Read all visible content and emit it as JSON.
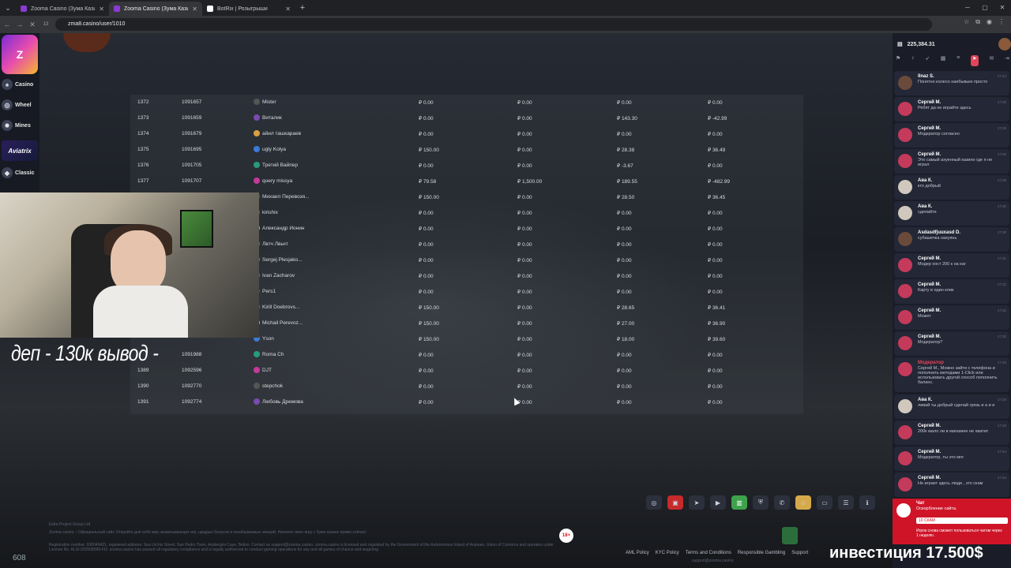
{
  "browser": {
    "tabs": [
      {
        "title": "Zooma Casino (Зума Казино) ...",
        "active": false
      },
      {
        "title": "Zooma Casino (Зума Казино) ...",
        "active": true
      },
      {
        "title": "BotRix | Розыгрыши",
        "active": false
      }
    ],
    "url": "zma8.casino/user/1010",
    "reload_label": "13"
  },
  "sidebar": {
    "logo_text": "Z",
    "items": [
      {
        "label": "Casino",
        "icon": "casino-icon"
      },
      {
        "label": "Wheel",
        "icon": "wheel-icon"
      },
      {
        "label": "Mines",
        "icon": "mines-icon"
      },
      {
        "label": "Classic",
        "icon": "classic-icon"
      }
    ],
    "aviatrix": "Aviatrix"
  },
  "table": {
    "rows": [
      {
        "id": "1372",
        "uid": "1091657",
        "name": "Mister",
        "a": "₽ 0.00",
        "b": "₽ 0.00",
        "c": "₽ 0.00",
        "d": "₽ 0.00"
      },
      {
        "id": "1373",
        "uid": "1091659",
        "name": "Виталик",
        "a": "₽ 0.00",
        "b": "₽ 0.00",
        "c": "₽ 143.30",
        "d": "₽ -42.99"
      },
      {
        "id": "1374",
        "uid": "1091679",
        "name": "айил ташкараев",
        "a": "₽ 0.00",
        "b": "₽ 0.00",
        "c": "₽ 0.00",
        "d": "₽ 0.00"
      },
      {
        "id": "1375",
        "uid": "1091695",
        "name": "ugly Kolya",
        "a": "₽ 150.00",
        "b": "₽ 0.00",
        "c": "₽ 28.38",
        "d": "₽ 36.49"
      },
      {
        "id": "1376",
        "uid": "1091705",
        "name": "Третий Вайпер",
        "a": "₽ 0.00",
        "b": "₽ 0.00",
        "c": "₽ -3.67",
        "d": "₽ 0.00"
      },
      {
        "id": "1377",
        "uid": "1091707",
        "name": "query missya",
        "a": "₽ 79.58",
        "b": "₽ 1,500.00",
        "c": "₽ 189.55",
        "d": "₽ -482.99"
      },
      {
        "id": "",
        "uid": "",
        "name": "Михаил Перевозя...",
        "a": "₽ 150.00",
        "b": "₽ 0.00",
        "c": "₽ 28.50",
        "d": "₽ 36.45"
      },
      {
        "id": "",
        "uid": "",
        "name": "kirishix",
        "a": "₽ 0.00",
        "b": "₽ 0.00",
        "c": "₽ 0.00",
        "d": "₽ 0.00"
      },
      {
        "id": "",
        "uid": "",
        "name": "Александр Ионин",
        "a": "₽ 0.00",
        "b": "₽ 0.00",
        "c": "₽ 0.00",
        "d": "₽ 0.00"
      },
      {
        "id": "",
        "uid": "",
        "name": "Лвтч Лвьчт",
        "a": "₽ 0.00",
        "b": "₽ 0.00",
        "c": "₽ 0.00",
        "d": "₽ 0.00"
      },
      {
        "id": "",
        "uid": "",
        "name": "Sergej Plesjako...",
        "a": "₽ 0.00",
        "b": "₽ 0.00",
        "c": "₽ 0.00",
        "d": "₽ 0.00"
      },
      {
        "id": "",
        "uid": "",
        "name": "Ivan Zacharov",
        "a": "₽ 0.00",
        "b": "₽ 0.00",
        "c": "₽ 0.00",
        "d": "₽ 0.00"
      },
      {
        "id": "",
        "uid": "",
        "name": "Pers1",
        "a": "₽ 0.00",
        "b": "₽ 0.00",
        "c": "₽ 0.00",
        "d": "₽ 0.00"
      },
      {
        "id": "",
        "uid": "",
        "name": "Kirill Doebrovs...",
        "a": "₽ 150.00",
        "b": "₽ 0.00",
        "c": "₽ 28.65",
        "d": "₽ 36.41"
      },
      {
        "id": "",
        "uid": "",
        "name": "Michail Perevoz...",
        "a": "₽ 150.00",
        "b": "₽ 0.00",
        "c": "₽ 27.00",
        "d": "₽ 36.90"
      },
      {
        "id": "",
        "uid": "",
        "name": "Yson",
        "a": "₽ 150.00",
        "b": "₽ 0.00",
        "c": "₽ 18.00",
        "d": "₽ 39.60"
      },
      {
        "id": "",
        "uid": "1091988",
        "name": "Roma Ch",
        "a": "₽ 0.00",
        "b": "₽ 0.00",
        "c": "₽ 0.00",
        "d": "₽ 0.00"
      },
      {
        "id": "1389",
        "uid": "1092596",
        "name": "DJT",
        "a": "₽ 0.00",
        "b": "₽ 0.00",
        "c": "₽ 0.00",
        "d": "₽ 0.00"
      },
      {
        "id": "1390",
        "uid": "1092770",
        "name": "stepchok",
        "a": "₽ 0.00",
        "b": "₽ 0.00",
        "c": "₽ 0.00",
        "d": "₽ 0.00"
      },
      {
        "id": "1391",
        "uid": "1092774",
        "name": "Любовь Дремова",
        "a": "₽ 0.00",
        "b": "₽ 0.00",
        "c": "₽ 0.00",
        "d": "₽ 0.00"
      }
    ]
  },
  "overlay": {
    "caption": "деп - 130к вывод -",
    "invest": "инвестиция 17.500$",
    "viewer_count": "608"
  },
  "chat": {
    "balance": "225,384.31",
    "messages": [
      {
        "name": "Ilnaz S.",
        "text": "Понятно колесо наебывыю просто",
        "time": "17:24"
      },
      {
        "name": "Сергей М.",
        "text": "Ребят да не играйте здесь",
        "time": "17:25"
      },
      {
        "name": "Сергей М.",
        "text": "Модератор согласен",
        "time": "17:25"
      },
      {
        "name": "Сергей М.",
        "text": "Это самый ахуенный казино где я не играл",
        "time": "17:26"
      },
      {
        "name": "Ава К.",
        "text": "кто добрый",
        "time": "17:29"
      },
      {
        "name": "Ава К.",
        "text": "сделайте",
        "time": "17:30"
      },
      {
        "name": "Asdasdfjuuxasd D.",
        "text": "субашечка нахуянь",
        "time": "17:30"
      },
      {
        "name": "Сергей М.",
        "text": "Модер хост 200 к на каг",
        "time": "17:31"
      },
      {
        "name": "Сергей М.",
        "text": "Карту в один клик",
        "time": "17:32"
      },
      {
        "name": "Сергей М.",
        "text": "Может",
        "time": "17:32"
      },
      {
        "name": "Сергей М.",
        "text": "Модератор?",
        "time": "17:32"
      },
      {
        "name": "Модератор",
        "text": "Сергей М., Можно зайти с телефона и пополнить методами 1-Click или использовать другой способ пополнить баланс.",
        "time": "17:33"
      },
      {
        "name": "Ава К.",
        "text": "ливай ты добрый сделай грязь и а и и",
        "time": "17:33"
      },
      {
        "name": "Сергей М.",
        "text": "200к мало ли в магазине не хватит",
        "time": "17:33"
      },
      {
        "name": "Сергей М.",
        "text": "Модератор, ты это мге",
        "time": "17:34"
      },
      {
        "name": "Сергей М.",
        "text": "Не играет здесь люди , это скам",
        "time": "17:34"
      }
    ],
    "notification": {
      "title": "Чат",
      "message": "Оскорбление сайта.",
      "quote": "10 СКАМ",
      "text": "Игрок снова сможет пользоваться чатом через 1 неделю."
    }
  },
  "footer": {
    "company": "Extra Project Group Ltd",
    "tagline": "Zooma casino – Официальный сайт. Откройте для себя мир захватывающих игр, щедрых бонусов и незабываемых эмоций. Начните свою игру с Зума казино прямо сейчас!",
    "legal": "Registration number: 000049421, registered address: Sea Urchin Street, San Pedro Town, Ambergris Caye, Belize. Contact us support@zooma.casino. zooma.casino is licensed and regulated by the Government of the Autonomous Island of Anjouan, Union of Comoros and operates under License No. ALSI-202508099-FI2. zooma.casino has passed all regulatory compliance and is legally authorized to conduct gaming operations for any and all games of chance and wagering.",
    "age": "18+",
    "links": [
      "AML Policy",
      "KYC Policy",
      "Terms and Conditions",
      "Responsible Gambling",
      "Support"
    ],
    "support_email": "support@zooma.casino"
  },
  "colors": {
    "accent": "#e0455a",
    "green": "#3ea24a",
    "notify": "#cf1428"
  }
}
